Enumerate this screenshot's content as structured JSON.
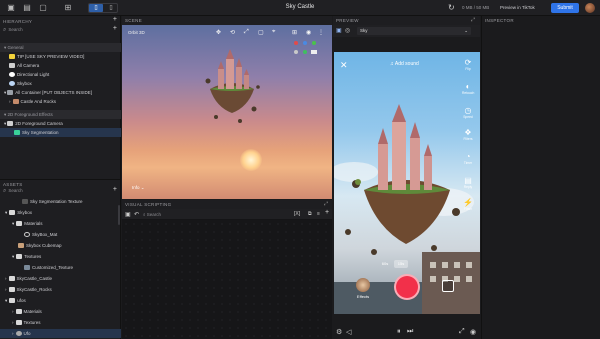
{
  "topbar": {
    "title": "Sky Castle",
    "memory": "0 MB / 50 MB",
    "preview_in_tiktok": "Preview in TikTok",
    "submit": "Submit"
  },
  "hierarchy": {
    "label": "HIERARCHY",
    "search_placeholder": "Search",
    "rows": [
      {
        "label": "General"
      },
      {
        "label": "TIP [USE SKY PREVIEW VIDEO]"
      },
      {
        "label": "All Camera"
      },
      {
        "label": "Directional Light"
      },
      {
        "label": "Skybox"
      },
      {
        "label": "All Container [PUT OBJECTS INSIDE]"
      },
      {
        "label": "Castle And Rocks"
      },
      {
        "label": "2D Foreground Effects"
      },
      {
        "label": "2D Foreground Camera"
      },
      {
        "label": "Sky Segmentation"
      }
    ]
  },
  "scene": {
    "label": "SCENE",
    "mode": "Orbit 3D",
    "info": "Info"
  },
  "visual_scripting": {
    "label": "VISUAL SCRIPTING",
    "search_placeholder": "Search"
  },
  "assets": {
    "label": "ASSETS",
    "search_placeholder": "Search",
    "rows": [
      {
        "label": "Sky Segmentation Texture"
      },
      {
        "label": "Skybox"
      },
      {
        "label": "Materials"
      },
      {
        "label": "SkyBox_Mat"
      },
      {
        "label": "Skybox Cubemap"
      },
      {
        "label": "Textures"
      },
      {
        "label": "Customized_Texture"
      },
      {
        "label": "SkyCastle_Castle"
      },
      {
        "label": "SkyCastle_Rocks"
      },
      {
        "label": "ufos"
      },
      {
        "label": "Materials"
      },
      {
        "label": "Textures"
      },
      {
        "label": "Ufo"
      }
    ]
  },
  "preview": {
    "label": "PREVIEW",
    "selected": "Sky",
    "add_sound": "Add sound",
    "rail": [
      {
        "label": "Flip",
        "icon": "flip-icon"
      },
      {
        "label": "Retouch",
        "icon": "retouch-icon"
      },
      {
        "label": "Speed",
        "icon": "speed-icon"
      },
      {
        "label": "Filters",
        "icon": "filters-icon"
      },
      {
        "label": "Timer",
        "icon": "timer-icon"
      },
      {
        "label": "Reply",
        "icon": "reply-icon"
      },
      {
        "label": "Flash",
        "icon": "flash-icon"
      }
    ],
    "speed_options": [
      "60s",
      "15s"
    ],
    "effects": "Effects"
  },
  "inspector": {
    "label": "INSPECTOR"
  },
  "colors": {
    "accent": "#2f74e8",
    "record": "#f2304a"
  }
}
